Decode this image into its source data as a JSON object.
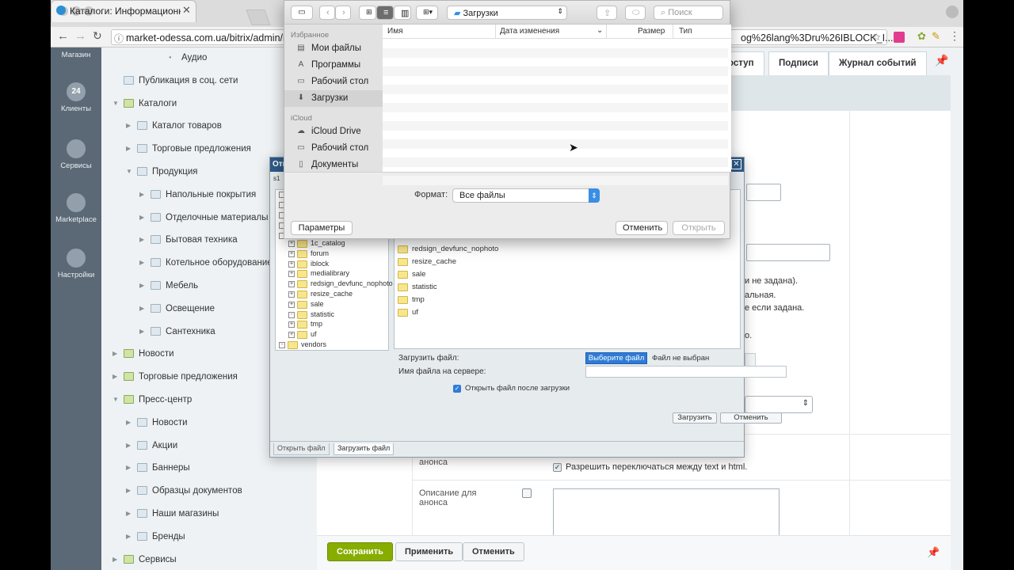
{
  "browser": {
    "tab_title": "Каталоги: Информационные",
    "url": "market-odessa.com.ua/bitrix/admin/ib",
    "url_tail": "og%26lang%3Dru%26IBLOCK_I..."
  },
  "leftbar": {
    "items": [
      {
        "label": "Магазин",
        "icon": "shop-icon"
      },
      {
        "label": "Клиенты",
        "icon": "clients-24-icon",
        "glyph": "24"
      },
      {
        "label": "Сервисы",
        "icon": "layers-icon"
      },
      {
        "label": "Marketplace",
        "icon": "cloud-download-icon"
      },
      {
        "label": "Настройки",
        "icon": "gear-icon"
      }
    ]
  },
  "tree": [
    {
      "label": "Аудио",
      "level": 3,
      "bullet": true
    },
    {
      "label": "Публикация в соц. сети",
      "level": 0,
      "special": true
    },
    {
      "label": "Каталоги",
      "level": 0,
      "open": true,
      "green": true
    },
    {
      "label": "Каталог товаров",
      "level": 1
    },
    {
      "label": "Торговые предложения",
      "level": 1
    },
    {
      "label": "Продукция",
      "level": 1,
      "open": true
    },
    {
      "label": "Напольные покрытия",
      "level": 2
    },
    {
      "label": "Отделочные материалы",
      "level": 2
    },
    {
      "label": "Бытовая техника",
      "level": 2
    },
    {
      "label": "Котельное оборудование",
      "level": 2
    },
    {
      "label": "Мебель",
      "level": 2
    },
    {
      "label": "Освещение",
      "level": 2
    },
    {
      "label": "Сантехника",
      "level": 2
    },
    {
      "label": "Новости",
      "level": 0,
      "green": true
    },
    {
      "label": "Торговые предложения",
      "level": 0,
      "green": true
    },
    {
      "label": "Пресс-центр",
      "level": 0,
      "open": true,
      "green": true
    },
    {
      "label": "Новости",
      "level": 1
    },
    {
      "label": "Акции",
      "level": 1
    },
    {
      "label": "Баннеры",
      "level": 1
    },
    {
      "label": "Образцы документов",
      "level": 1
    },
    {
      "label": "Наши магазины",
      "level": 1
    },
    {
      "label": "Бренды",
      "level": 1
    },
    {
      "label": "Сервисы",
      "level": 0,
      "green": true
    }
  ],
  "main": {
    "tabs": [
      "оступ",
      "Подписи",
      "Журнал событий"
    ],
    "frag1": "и не задана).",
    "frag2": "альная.",
    "frag3": "е если задана.",
    "frag4": "о.",
    "anons_label": "анонса",
    "toggle_text": "Разрешить переключаться между text и html.",
    "desc_label_1": "Описание для",
    "desc_label_2": "анонса",
    "buttons": {
      "save": "Сохранить",
      "apply": "Применить",
      "cancel": "Отменить"
    }
  },
  "finder": {
    "location": "Загрузки",
    "search_placeholder": "Поиск",
    "sections": {
      "favorites": "Избранное",
      "icloud": "iCloud"
    },
    "favorites": [
      {
        "label": "Мои файлы",
        "icon": "all-files-icon"
      },
      {
        "label": "Программы",
        "icon": "applications-icon"
      },
      {
        "label": "Рабочий стол",
        "icon": "desktop-icon"
      },
      {
        "label": "Загрузки",
        "icon": "downloads-icon"
      }
    ],
    "icloud_items": [
      {
        "label": "iCloud Drive",
        "icon": "icloud-icon"
      },
      {
        "label": "Рабочий стол",
        "icon": "desktop-icon"
      },
      {
        "label": "Документы",
        "icon": "documents-icon"
      }
    ],
    "columns": {
      "name": "Имя",
      "date": "Дата изменения",
      "size": "Размер",
      "type": "Тип"
    },
    "format_label": "Формат:",
    "format_value": "Все файлы",
    "params_button": "Параметры",
    "cancel_button": "Отменить",
    "open_button": "Открыть"
  },
  "bxdialog": {
    "title": "Отк",
    "site": "s1",
    "tree": [
      {
        "label": "1c_catalog",
        "sign": "+"
      },
      {
        "label": "forum",
        "sign": "+"
      },
      {
        "label": "iblock",
        "sign": "+"
      },
      {
        "label": "medialibrary",
        "sign": "+"
      },
      {
        "label": "redsign_devfunc_nophoto",
        "sign": "+"
      },
      {
        "label": "resize_cache",
        "sign": "+"
      },
      {
        "label": "sale",
        "sign": "+"
      },
      {
        "label": "statistic",
        "sign": "-"
      },
      {
        "label": "tmp",
        "sign": "+"
      },
      {
        "label": "uf",
        "sign": "+"
      },
      {
        "label": "vendors",
        "sign": "-",
        "root": true
      }
    ],
    "files": [
      "redsign_devfunc_nophoto",
      "resize_cache",
      "sale",
      "statistic",
      "tmp",
      "uf"
    ],
    "upload_label": "Загрузить файл:",
    "choose_button": "Выберите файл",
    "no_file": "Файл не выбран",
    "server_name_label": "Имя файла на сервере:",
    "open_after_label": "Открыть файл после загрузки",
    "upload_button": "Загрузить",
    "cancel_button": "Отменить",
    "tab_open": "Открыть файл",
    "tab_upload": "Загрузить файл"
  }
}
